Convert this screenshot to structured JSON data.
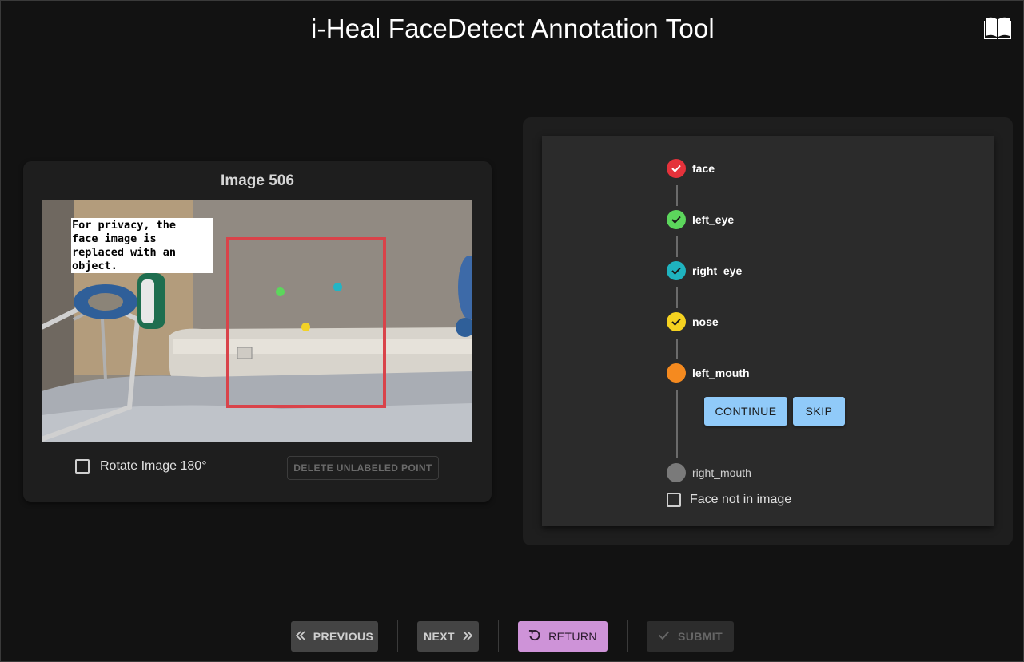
{
  "header": {
    "title": "i-Heal FaceDetect Annotation Tool",
    "help_icon": "book-open-icon"
  },
  "image_panel": {
    "title": "Image 506",
    "privacy_note": "For privacy, the\nface image is\nreplaced with an\nobject.",
    "bbox_color": "#d9434a",
    "points": [
      {
        "name": "left_eye",
        "color": "#5cd65c"
      },
      {
        "name": "right_eye",
        "color": "#22b5c5"
      },
      {
        "name": "nose",
        "color": "#f2d227"
      }
    ],
    "rotate_label": "Rotate Image 180°",
    "rotate_checked": false,
    "delete_button": "DELETE UNLABELED POINT"
  },
  "steps_panel": {
    "steps": [
      {
        "label": "face",
        "color": "#e5323b",
        "state": "done"
      },
      {
        "label": "left_eye",
        "color": "#5cd65c",
        "state": "done"
      },
      {
        "label": "right_eye",
        "color": "#1fb3bf",
        "state": "done"
      },
      {
        "label": "nose",
        "color": "#f5d220",
        "state": "done"
      },
      {
        "label": "left_mouth",
        "color": "#f58a1f",
        "state": "active"
      },
      {
        "label": "right_mouth",
        "color": "#7a7a7a",
        "state": "pending"
      }
    ],
    "continue_button": "CONTINUE",
    "skip_button": "SKIP",
    "face_not_in_image_label": "Face not in image",
    "face_not_in_image_checked": false
  },
  "nav": {
    "previous": "PREVIOUS",
    "next": "NEXT",
    "return": "RETURN",
    "submit": "SUBMIT",
    "return_color": "#ce93d8"
  }
}
